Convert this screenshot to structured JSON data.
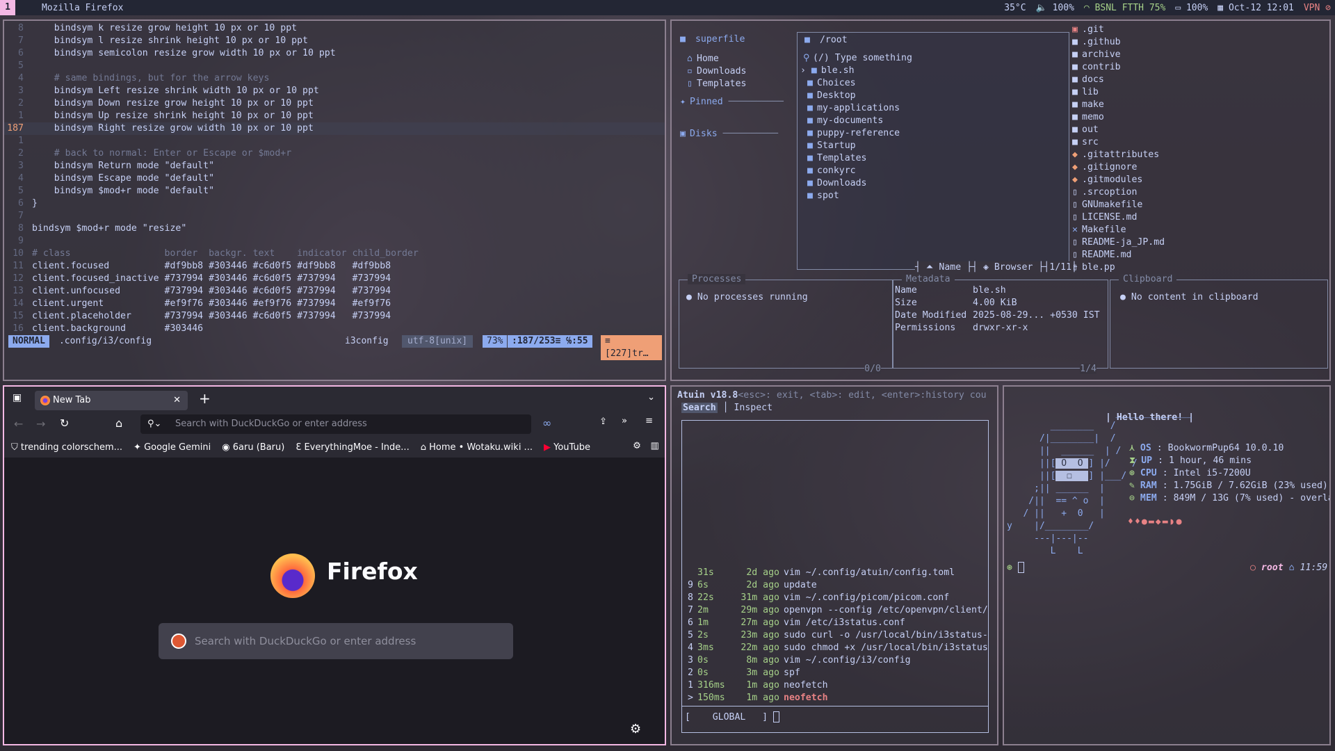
{
  "topbar": {
    "workspace": "1",
    "title": "Mozilla Firefox",
    "temp": "35°C",
    "volume": "🔈 100%",
    "wifi": "BSNL FTTH 75%",
    "battery": "100%",
    "datetime": "Oct-12 12:01",
    "vpn": "VPN"
  },
  "vim": {
    "lines": [
      {
        "n": "8",
        "t": "    bindsym k resize grow height 10 px or 10 ppt"
      },
      {
        "n": "7",
        "t": "    bindsym l resize shrink height 10 px or 10 ppt"
      },
      {
        "n": "6",
        "t": "    bindsym semicolon resize grow width 10 px or 10 ppt"
      },
      {
        "n": "5",
        "t": ""
      },
      {
        "n": "4",
        "t": "    # same bindings, but for the arrow keys"
      },
      {
        "n": "3",
        "t": "    bindsym Left resize shrink width 10 px or 10 ppt"
      },
      {
        "n": "2",
        "t": "    bindsym Down resize grow height 10 px or 10 ppt"
      },
      {
        "n": "1",
        "t": "    bindsym Up resize shrink height 10 px or 10 ppt"
      },
      {
        "n": "187",
        "t": "    bindsym Right resize grow width 10 px or 10 ppt"
      },
      {
        "n": "1",
        "t": ""
      },
      {
        "n": "2",
        "t": "    # back to normal: Enter or Escape or $mod+r"
      },
      {
        "n": "3",
        "t": "    bindsym Return mode \"default\""
      },
      {
        "n": "4",
        "t": "    bindsym Escape mode \"default\""
      },
      {
        "n": "5",
        "t": "    bindsym $mod+r mode \"default\""
      },
      {
        "n": "6",
        "t": "}"
      },
      {
        "n": "7",
        "t": ""
      },
      {
        "n": "8",
        "t": "bindsym $mod+r mode \"resize\""
      },
      {
        "n": "9",
        "t": ""
      },
      {
        "n": "10",
        "t": "# class                 border  backgr. text    indicator child_border"
      },
      {
        "n": "11",
        "t": "client.focused          #df9bb8 #303446 #c6d0f5 #df9bb8   #df9bb8"
      },
      {
        "n": "12",
        "t": "client.focused_inactive #737994 #303446 #c6d0f5 #737994   #737994"
      },
      {
        "n": "13",
        "t": "client.unfocused        #737994 #303446 #c6d0f5 #737994   #737994"
      },
      {
        "n": "14",
        "t": "client.urgent           #ef9f76 #303446 #ef9f76 #737994   #ef9f76"
      },
      {
        "n": "15",
        "t": "client.placeholder      #737994 #303446 #c6d0f5 #737994   #737994"
      },
      {
        "n": "16",
        "t": "client.background       #303446"
      }
    ],
    "status": {
      "mode": "NORMAL",
      "file": ".config/i3/config",
      "filetype": "i3config",
      "encoding": "utf-8[unix]",
      "percent": "73%",
      "position": ":187/253≡ ℅:55",
      "trailing": "≡ [227]tr…"
    }
  },
  "superfile": {
    "sidebar_title": "superfile",
    "home": "Home",
    "downloads": "Downloads",
    "templates": "Templates",
    "pinned": "Pinned",
    "disks": "Disks",
    "path": "/root",
    "search_placeholder": "(/) Type something",
    "files": [
      "ble.sh",
      "Choices",
      "Desktop",
      "my-applications",
      "my-documents",
      "puppy-reference",
      "Startup",
      "Templates",
      "conkyrc",
      "Downloads",
      "spot"
    ],
    "footer_sort": "Name",
    "footer_mode": "Browser",
    "footer_count": "1/11",
    "right_files": [
      ".git",
      ".github",
      "archive",
      "contrib",
      "docs",
      "lib",
      "make",
      "memo",
      "out",
      "src",
      ".gitattributes",
      ".gitignore",
      ".gitmodules",
      ".srcoption",
      "GNUmakefile",
      "LICENSE.md",
      "Makefile",
      "README-ja_JP.md",
      "README.md",
      "ble.pp"
    ],
    "processes_title": "Processes",
    "processes_empty": "No processes running",
    "processes_count": "0/0",
    "metadata_title": "Metadata",
    "metadata": [
      {
        "k": "Name",
        "v": "ble.sh"
      },
      {
        "k": "Size",
        "v": "4.00 KiB"
      },
      {
        "k": "Date Modified",
        "v": "2025-08-29... +0530 IST"
      },
      {
        "k": "Permissions",
        "v": "drwxr-xr-x"
      }
    ],
    "metadata_count": "1/4",
    "clipboard_title": "Clipboard",
    "clipboard_empty": "No content in clipboard"
  },
  "firefox": {
    "tab_title": "New Tab",
    "url_placeholder": "Search with DuckDuckGo or enter address",
    "bookmarks": [
      "trending colorschem...",
      "Google Gemini",
      "6aru (Baru)",
      "EverythingMoe - Inde...",
      "Home • Wotaku.wiki ...",
      "YouTube"
    ],
    "brand": "Firefox",
    "search_placeholder": "Search with DuckDuckGo or enter address"
  },
  "atuin": {
    "title": "Atuin v18.8",
    "hint": "<esc>: exit, <tab>: edit, <enter>:history cou",
    "tab_search": "Search",
    "tab_inspect": "Inspect",
    "history": [
      {
        "i": " ",
        "dur": "31s",
        "ago": "2d ago",
        "cmd": "vim ~/.config/atuin/config.toml"
      },
      {
        "i": "9",
        "dur": "6s",
        "ago": "2d ago",
        "cmd": "update"
      },
      {
        "i": "8",
        "dur": "22s",
        "ago": "31m ago",
        "cmd": "vim ~/.config/picom/picom.conf"
      },
      {
        "i": "7",
        "dur": "2m",
        "ago": "29m ago",
        "cmd": "openvpn --config /etc/openvpn/client/"
      },
      {
        "i": "6",
        "dur": "1m",
        "ago": "27m ago",
        "cmd": "vim /etc/i3status.conf"
      },
      {
        "i": "5",
        "dur": "2s",
        "ago": "23m ago",
        "cmd": "sudo curl -o /usr/local/bin/i3status-"
      },
      {
        "i": "4",
        "dur": "3ms",
        "ago": "22m ago",
        "cmd": "sudo chmod +x /usr/local/bin/i3status"
      },
      {
        "i": "3",
        "dur": "0s",
        "ago": "8m ago",
        "cmd": "vim ~/.config/i3/config"
      },
      {
        "i": "2",
        "dur": "0s",
        "ago": "3m ago",
        "cmd": "spf"
      },
      {
        "i": "1",
        "dur": "316ms",
        "ago": "1m ago",
        "cmd": "neofetch"
      },
      {
        "i": ">",
        "dur": "150ms",
        "ago": "1m ago",
        "cmd": "neofetch"
      }
    ],
    "filter": "GLOBAL"
  },
  "fetch": {
    "bubble": "| Hello there! |",
    "info": [
      {
        "k": "OS",
        "v": ": BookwormPup64 10.0.10"
      },
      {
        "k": "UP",
        "v": ": 1 hour, 46 mins"
      },
      {
        "k": "CPU",
        "v": ": Intel i5-7200U"
      },
      {
        "k": "RAM",
        "v": ": 1.75GiB / 7.62GiB (23% used)"
      },
      {
        "k": "MEM",
        "v": ": 849M / 13G (7% used) - overla"
      }
    ],
    "prompt_user": "root",
    "prompt_time": "11:59"
  }
}
